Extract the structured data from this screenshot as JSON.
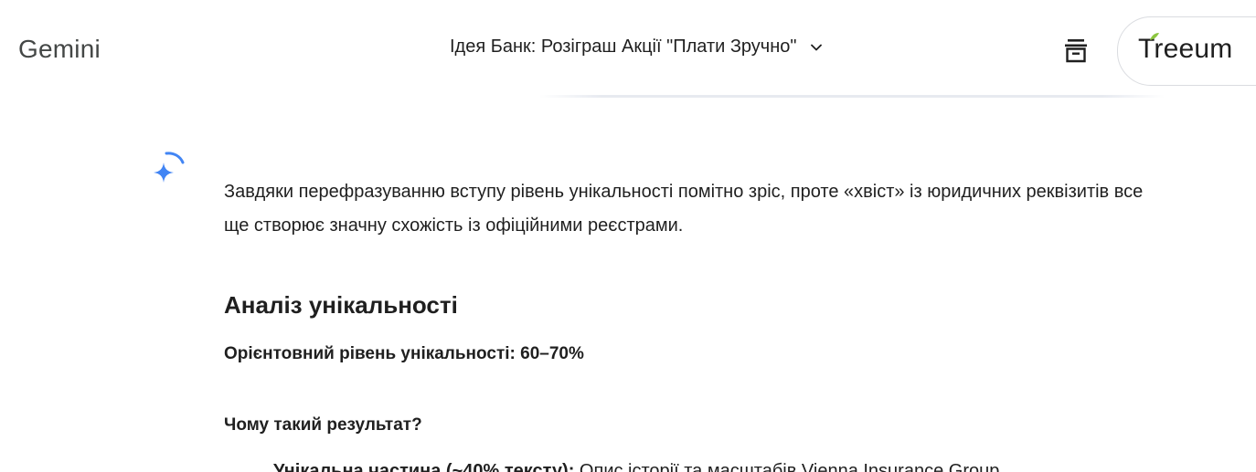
{
  "header": {
    "app_name": "Gemini",
    "conversation_title": "Ідея Банк: Розіграш Акції \"Плати Зручно\"",
    "brand_text": "Treeum"
  },
  "response": {
    "intro": "Завдяки перефразуванню вступу рівень унікальності помітно зріс, проте «хвіст» із юридичних реквізитів все ще створює значну схожість із офіційними реєстрами.",
    "heading": "Аналіз унікальності",
    "uniqueness_line": "Орієнтовний рівень унікальності: 60–70%",
    "why_heading": "Чому такий результат?",
    "bullet_bold": "Унікальна частина (~40% тексту):",
    "bullet_text": " Опис історії та масштабів Vienna Insurance Group"
  },
  "icons": {
    "chevron": "chevron-down-icon",
    "action": "archive-icon",
    "spark": "gemini-spark-icon"
  },
  "colors": {
    "spark_blue": "#4285f4"
  }
}
